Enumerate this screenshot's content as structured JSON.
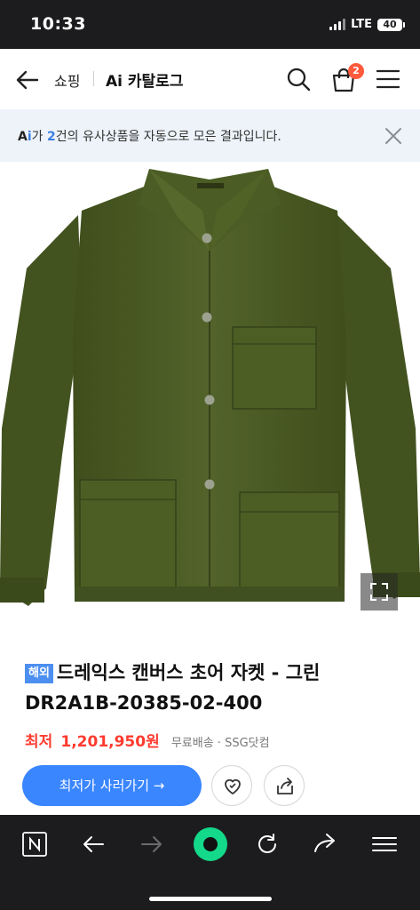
{
  "status_bar": {
    "time": "10:33",
    "network": "LTE",
    "battery": "40"
  },
  "header": {
    "breadcrumb_shop": "쇼핑",
    "title": "Ai 카탈로그",
    "cart_count": "2",
    "icons": [
      "back-arrow-icon",
      "search-icon",
      "shopping-bag-icon",
      "hamburger-menu-icon"
    ]
  },
  "ai_notice": {
    "prefix": "가",
    "count": "2",
    "message": "건의 유사상품을 자동으로 모은 결과입니다."
  },
  "product": {
    "badge": "해외",
    "title": "드레익스 캔버스 초어 자켓 - 그린 DR2A1B-20385-02-400",
    "price_label": "최저",
    "price": "1,201,950원",
    "shipping": "무료배송 · SSG닷컴",
    "buy_button": "최저가 사러가기 →"
  },
  "colors": {
    "accent": "#3a86ff",
    "price": "#ff3b30",
    "notice_bg": "#eef3f9",
    "jacket": "#4a5b23"
  },
  "browser_toolbar": {
    "icons": [
      "naver-n-icon",
      "back-icon",
      "forward-icon",
      "green-home-icon",
      "refresh-icon",
      "share-icon",
      "menu-icon"
    ]
  }
}
